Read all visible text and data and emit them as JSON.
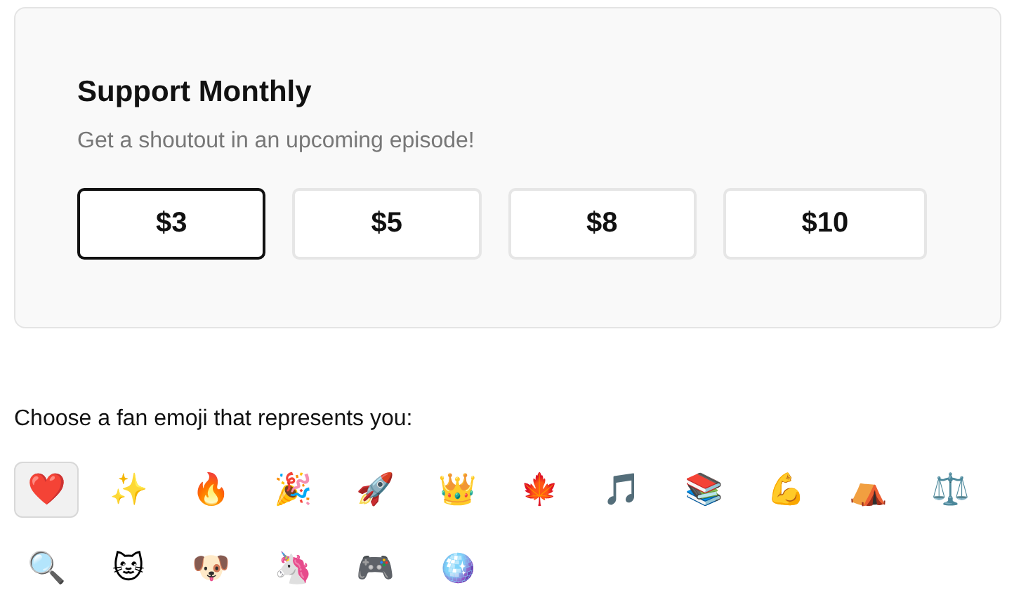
{
  "support": {
    "title": "Support Monthly",
    "subtitle": "Get a shoutout in an upcoming episode!",
    "amounts": [
      {
        "label": "$3",
        "selected": true
      },
      {
        "label": "$5",
        "selected": false
      },
      {
        "label": "$8",
        "selected": false
      },
      {
        "label": "$10",
        "selected": false
      }
    ]
  },
  "emoji_picker": {
    "prompt": "Choose a fan emoji that represents you:",
    "emojis": [
      {
        "label": "❤️",
        "selected": true
      },
      {
        "label": "✨",
        "selected": false
      },
      {
        "label": "🔥",
        "selected": false
      },
      {
        "label": "🎉",
        "selected": false
      },
      {
        "label": "🚀",
        "selected": false
      },
      {
        "label": "👑",
        "selected": false
      },
      {
        "label": "🍁",
        "selected": false
      },
      {
        "label": "🎵",
        "selected": false
      },
      {
        "label": "📚",
        "selected": false
      },
      {
        "label": "💪",
        "selected": false
      },
      {
        "label": "⛺",
        "selected": false
      },
      {
        "label": "⚖️",
        "selected": false
      },
      {
        "label": "🔍",
        "selected": false
      },
      {
        "label": "🐱",
        "selected": false
      },
      {
        "label": "🐶",
        "selected": false
      },
      {
        "label": "🦄",
        "selected": false
      },
      {
        "label": "🎮",
        "selected": false
      },
      {
        "label": "🪩",
        "selected": false
      }
    ]
  }
}
